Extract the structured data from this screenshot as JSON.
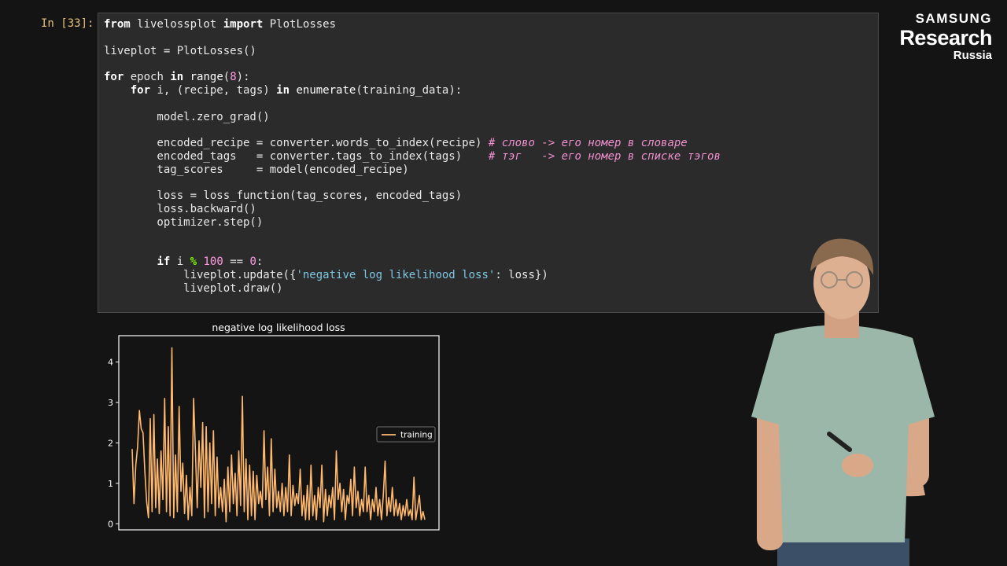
{
  "cell": {
    "prompt": "In [33]:",
    "lines": [
      [
        [
          "kw",
          "from"
        ],
        [
          "t",
          " liveloss"
        ],
        [
          "t",
          "plot "
        ],
        [
          "kw",
          "import"
        ],
        [
          "t",
          " PlotLosses"
        ]
      ],
      [],
      [
        [
          "t",
          "liveplot = PlotLosses()"
        ]
      ],
      [],
      [
        [
          "kw",
          "for"
        ],
        [
          "t",
          " epoch "
        ],
        [
          "kw",
          "in"
        ],
        [
          "t",
          " "
        ],
        [
          "bi",
          "range"
        ],
        [
          "t",
          "("
        ],
        [
          "num",
          "8"
        ],
        [
          "t",
          "):"
        ]
      ],
      [
        [
          "t",
          "    "
        ],
        [
          "kw",
          "for"
        ],
        [
          "t",
          " i, (recipe, tags) "
        ],
        [
          "kw",
          "in"
        ],
        [
          "t",
          " "
        ],
        [
          "bi",
          "enumerate"
        ],
        [
          "t",
          "(training_data):"
        ]
      ],
      [],
      [
        [
          "t",
          "        model.zero_grad()"
        ]
      ],
      [],
      [
        [
          "t",
          "        encoded_recipe = converter.words_to_index(recipe) "
        ],
        [
          "cm",
          "# слово -> его номер в словаре"
        ]
      ],
      [
        [
          "t",
          "        encoded_tags   = converter.tags_to_index(tags)    "
        ],
        [
          "cm",
          "# тэг   -> его номер в списке тэгов"
        ]
      ],
      [
        [
          "t",
          "        tag_scores     = model(encoded_recipe)"
        ]
      ],
      [],
      [
        [
          "t",
          "        loss = loss_function(tag_scores, encoded_tags)"
        ]
      ],
      [
        [
          "t",
          "        loss.backward()"
        ]
      ],
      [
        [
          "t",
          "        optimizer.step()"
        ]
      ],
      [],
      [],
      [
        [
          "t",
          "        "
        ],
        [
          "kw",
          "if"
        ],
        [
          "t",
          " i "
        ],
        [
          "op",
          "%"
        ],
        [
          "t",
          " "
        ],
        [
          "num",
          "100"
        ],
        [
          "t",
          " == "
        ],
        [
          "num",
          "0"
        ],
        [
          "t",
          ":"
        ]
      ],
      [
        [
          "t",
          "            liveplot.update({"
        ],
        [
          "str",
          "'negative log likelihood loss'"
        ],
        [
          "t",
          ": loss})"
        ]
      ],
      [
        [
          "t",
          "            liveplot.draw()"
        ]
      ]
    ]
  },
  "logo": {
    "line1": "SAMSUNG",
    "line2": "Research",
    "line3": "Russia"
  },
  "chart_data": {
    "type": "line",
    "title": "negative log likelihood loss",
    "xlabel": "",
    "ylabel": "",
    "ylim": [
      -0.15,
      4.65
    ],
    "yticks": [
      0,
      1,
      2,
      3,
      4
    ],
    "legend": "center-right",
    "series": [
      {
        "name": "training",
        "color": "#ffb86c",
        "values": [
          1.85,
          0.5,
          1.45,
          1.9,
          2.8,
          2.35,
          2.25,
          1.3,
          0.55,
          0.15,
          2.6,
          0.3,
          2.7,
          0.4,
          1.6,
          0.25,
          1.8,
          0.6,
          3.1,
          0.3,
          2.4,
          0.2,
          4.35,
          0.15,
          1.7,
          0.3,
          2.9,
          0.8,
          1.5,
          0.25,
          1.2,
          0.1,
          0.9,
          0.2,
          3.1,
          1.8,
          0.4,
          2.05,
          0.9,
          2.5,
          0.15,
          2.4,
          0.3,
          2.0,
          0.5,
          2.3,
          0.2,
          1.65,
          0.4,
          0.9,
          0.3,
          1.1,
          0.05,
          1.4,
          0.3,
          1.7,
          0.5,
          1.25,
          0.2,
          1.8,
          0.45,
          3.15,
          0.3,
          1.6,
          0.1,
          1.45,
          0.2,
          1.3,
          0.1,
          1.2,
          0.5,
          0.8,
          0.4,
          2.3,
          0.6,
          1.4,
          0.2,
          2.1,
          0.3,
          1.35,
          0.4,
          0.8,
          0.3,
          1.0,
          0.2,
          0.9,
          0.3,
          1.7,
          0.2,
          0.95,
          0.45,
          0.75,
          0.5,
          1.35,
          0.2,
          0.7,
          0.1,
          0.95,
          0.1,
          1.45,
          0.2,
          0.7,
          0.1,
          0.9,
          0.4,
          1.45,
          0.05,
          0.85,
          0.2,
          0.7,
          0.4,
          0.9,
          0.1,
          1.8,
          0.6,
          1.0,
          0.3,
          0.85,
          0.1,
          0.7,
          0.5,
          1.1,
          0.2,
          1.4,
          0.4,
          0.8,
          0.2,
          0.6,
          0.3,
          1.4,
          0.3,
          0.7,
          0.1,
          0.6,
          0.3,
          0.9,
          0.2,
          0.6,
          0.1,
          0.7,
          1.55,
          0.2,
          0.65,
          0.3,
          0.9,
          0.2,
          0.6,
          0.2,
          0.5,
          0.1,
          0.45,
          0.2,
          0.6,
          0.2,
          0.35,
          0.1,
          1.15,
          0.1,
          0.4,
          0.7,
          0.1,
          0.3,
          0.1
        ]
      }
    ]
  }
}
